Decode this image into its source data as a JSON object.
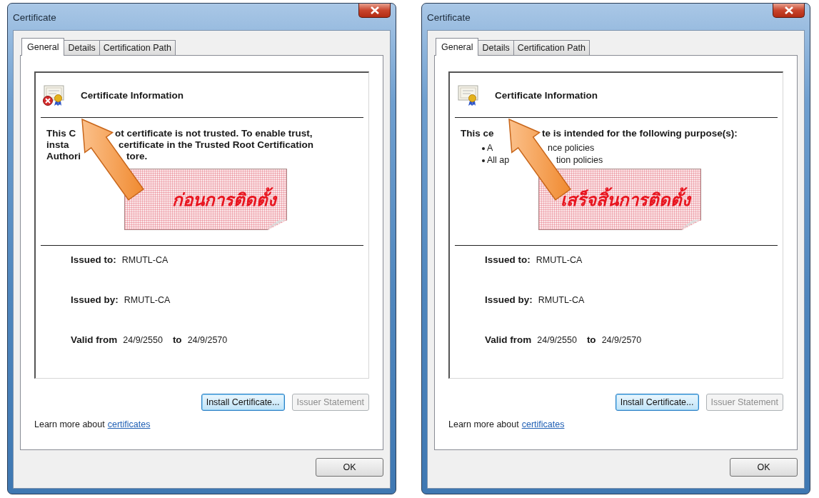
{
  "dialogs": [
    {
      "title": "Certificate",
      "tabs": [
        {
          "label": "General",
          "selected": true
        },
        {
          "label": "Details",
          "selected": false
        },
        {
          "label": "Certification Path",
          "selected": false
        }
      ],
      "trusted": false,
      "info_heading": "Certificate Information",
      "message_lines": [
        {
          "parts": [
            "This C",
            "ot certificate is not trusted. To enable trust,"
          ]
        },
        {
          "parts": [
            "insta",
            "certificate in the Trusted Root Certification"
          ]
        },
        {
          "parts": [
            "Authori",
            "tore."
          ]
        }
      ],
      "note": "ก่อนการติดตั้ง",
      "fields": [
        {
          "label": "Issued to:",
          "value": "RMUTL-CA"
        },
        {
          "label": "Issued by:",
          "value": "RMUTL-CA"
        }
      ],
      "validity": {
        "label": "Valid from",
        "from": "24/9/2550",
        "to_label": "to",
        "to": "24/9/2570"
      },
      "buttons": [
        {
          "label": "Install Certificate...",
          "disabled": false,
          "default": true
        },
        {
          "label": "Issuer Statement",
          "disabled": true,
          "default": false
        }
      ],
      "learn_more": "Learn more about",
      "link": "certificates",
      "ok": "OK"
    },
    {
      "title": "Certificate",
      "tabs": [
        {
          "label": "General",
          "selected": true
        },
        {
          "label": "Details",
          "selected": false
        },
        {
          "label": "Certification Path",
          "selected": false
        }
      ],
      "trusted": true,
      "info_heading": "Certificate Information",
      "message_lines": [
        {
          "parts": [
            "This ce",
            "te is intended for the following purpose(s):"
          ]
        }
      ],
      "purposes": [
        {
          "parts": [
            "A",
            "nce policies"
          ]
        },
        {
          "parts": [
            "All ap",
            "tion policies"
          ]
        }
      ],
      "note": "เสร็จสิ้นการติดตั้ง",
      "fields": [
        {
          "label": "Issued to:",
          "value": "RMUTL-CA"
        },
        {
          "label": "Issued by:",
          "value": "RMUTL-CA"
        }
      ],
      "validity": {
        "label": "Valid from",
        "from": "24/9/2550",
        "to_label": "to",
        "to": "24/9/2570"
      },
      "buttons": [
        {
          "label": "Install Certificate...",
          "disabled": false,
          "default": true
        },
        {
          "label": "Issuer Statement",
          "disabled": true,
          "default": false
        }
      ],
      "learn_more": "Learn more about",
      "link": "certificates",
      "ok": "OK"
    }
  ]
}
